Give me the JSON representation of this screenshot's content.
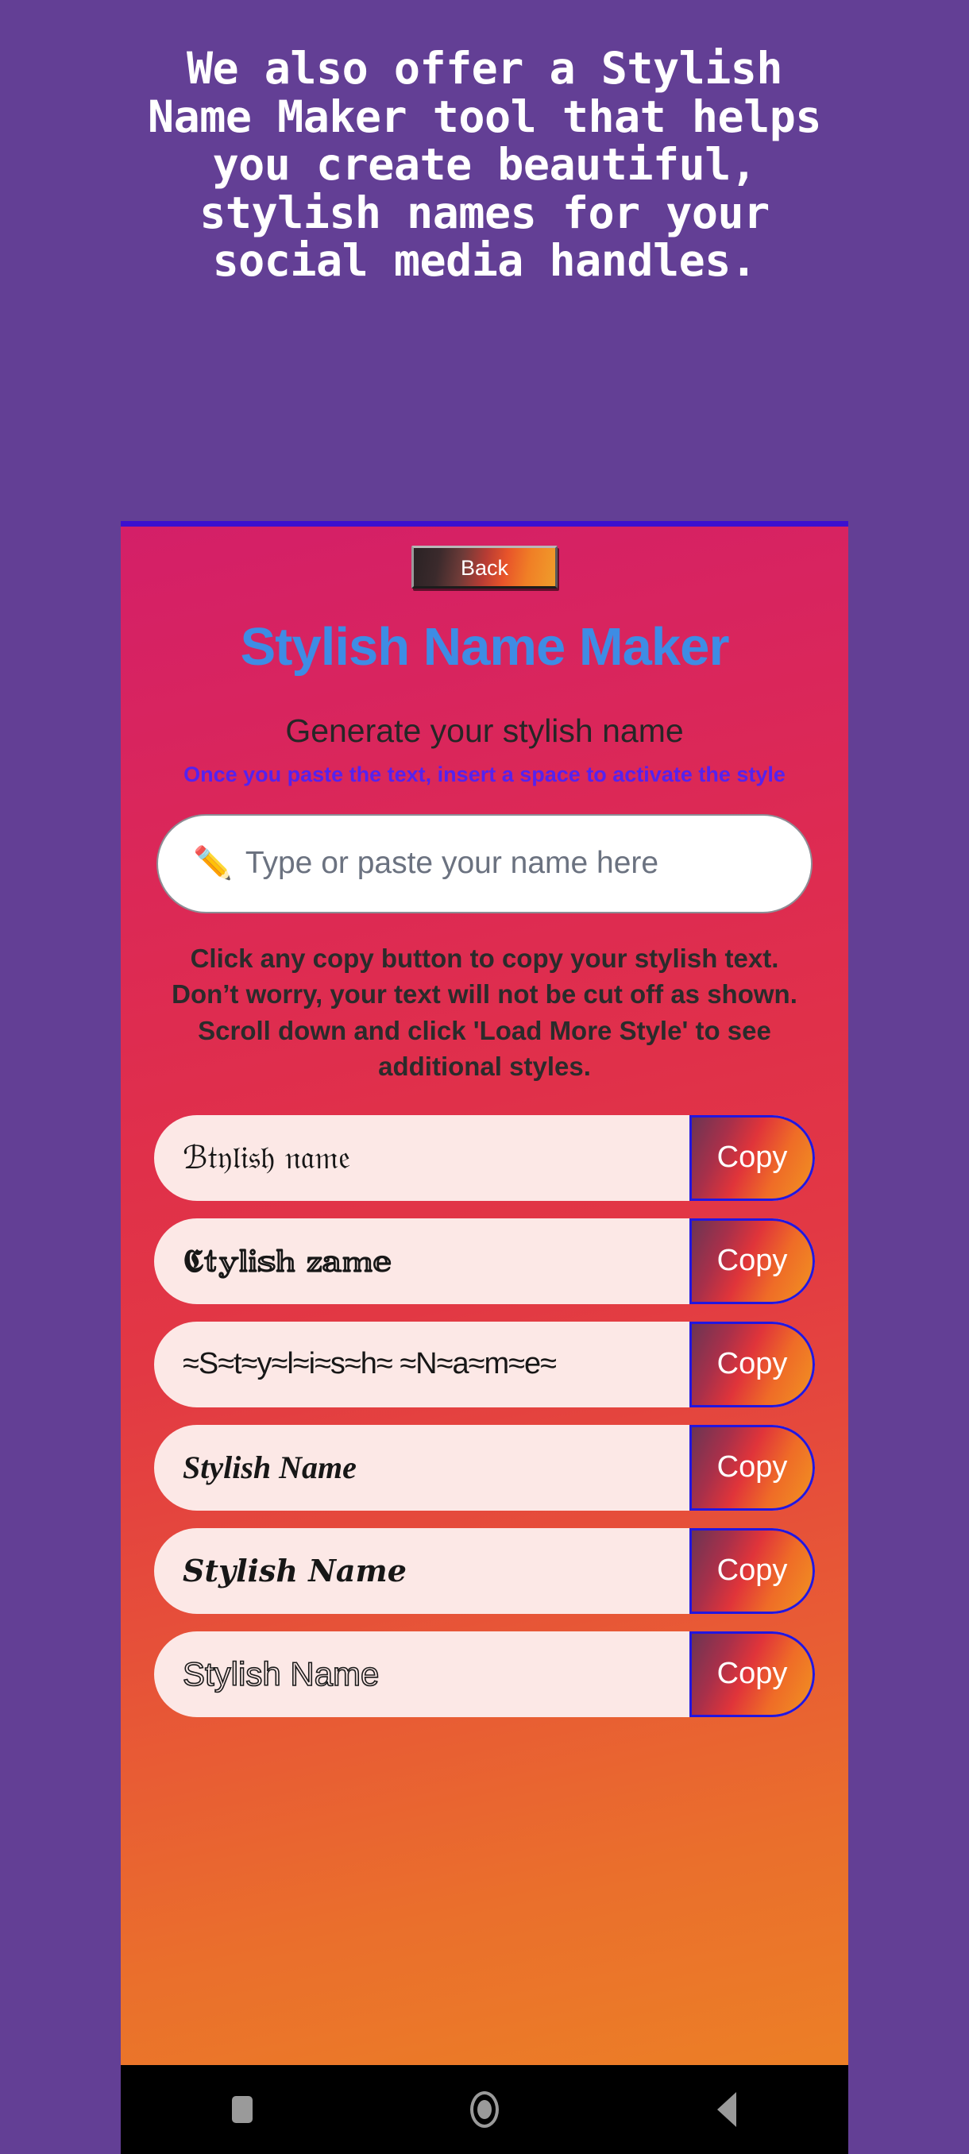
{
  "promo": {
    "heading": "We also offer a Stylish\nName Maker tool that helps\nyou create beautiful,\nstylish names for your\nsocial media handles."
  },
  "colors": {
    "page_background": "#633f95",
    "screen_gradient_start": "#d41f68",
    "screen_gradient_end": "#ec7f26",
    "title_blue": "#3e8ce4",
    "hint_purple": "#5522ee",
    "row_background": "#fce8e6",
    "copy_border_blue": "#2216e0",
    "navbar_background": "#000000",
    "phone_topline": "#3b10cf"
  },
  "app": {
    "back_label": "Back",
    "title": "Stylish Name Maker",
    "subtitle": "Generate your stylish name",
    "hint_prefix": "Once you paste the text, insert a ",
    "hint_bold": "space",
    "hint_suffix": " to activate the style",
    "input": {
      "icon": "pencil-icon",
      "icon_glyph": "✏️",
      "placeholder": "Type or paste your name here",
      "value": ""
    },
    "instruction": "Click any copy button to copy your stylish text. Don’t worry, your text will not be cut off as shown. Scroll down and click 'Load More Style' to see additional styles.",
    "copy_label": "Copy",
    "styles": [
      {
        "text": "ℬ𝔱𝔶𝔩𝔦𝔰𝔥 𝔫𝔞𝔪𝔢",
        "variant": "fraktur"
      },
      {
        "text": "𝕮𝕥𝕪𝕝𝕚𝕤𝕙 𝕫𝕒𝕞𝕖",
        "variant": "fraktur-bold"
      },
      {
        "text": "≈S≈t≈y≈l≈i≈s≈h≈ ≈N≈a≈m≈e≈",
        "variant": "wave"
      },
      {
        "text": "Stylish Name",
        "variant": "script"
      },
      {
        "text": "Stylish Name",
        "variant": "script-alt"
      },
      {
        "text": "Stylish Name",
        "variant": "outline"
      }
    ]
  },
  "navbar": {
    "items": [
      {
        "name": "recents-square-icon",
        "label": "Recents"
      },
      {
        "name": "home-circle-icon",
        "label": "Home"
      },
      {
        "name": "back-triangle-icon",
        "label": "Back"
      }
    ]
  }
}
